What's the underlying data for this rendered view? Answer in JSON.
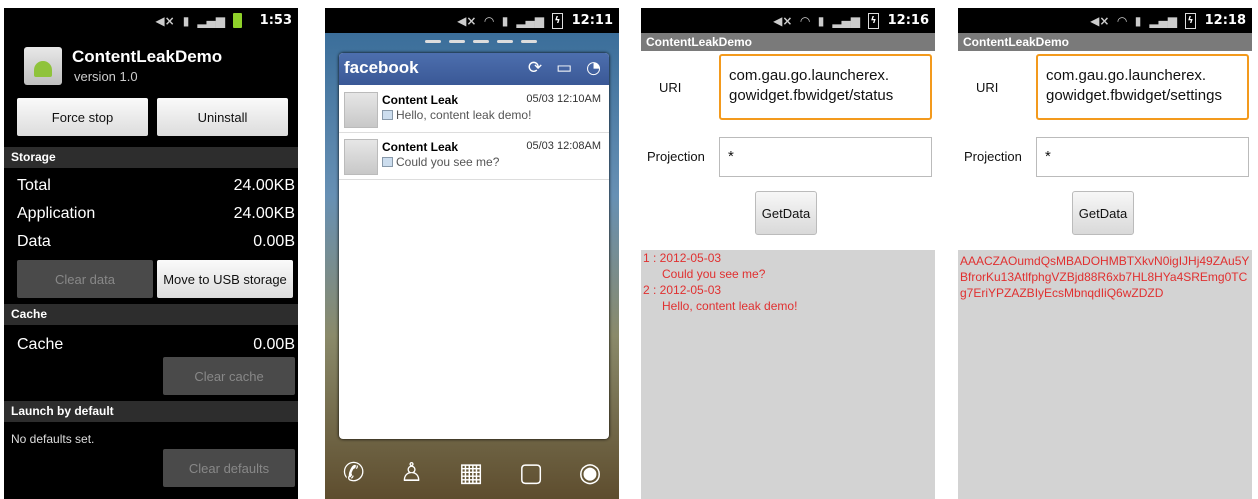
{
  "phone1": {
    "time": "1:53",
    "app_name": "ContentLeakDemo",
    "version": "version 1.0",
    "force_stop": "Force stop",
    "uninstall": "Uninstall",
    "storage_header": "Storage",
    "total_label": "Total",
    "total_value": "24.00KB",
    "application_label": "Application",
    "application_value": "24.00KB",
    "data_label": "Data",
    "data_value": "0.00B",
    "clear_data": "Clear data",
    "move_usb": "Move to USB storage",
    "cache_header": "Cache",
    "cache_label": "Cache",
    "cache_value": "0.00B",
    "clear_cache": "Clear cache",
    "launch_header": "Launch by default",
    "no_defaults": "No defaults set.",
    "clear_defaults": "Clear defaults"
  },
  "phone2": {
    "time": "12:11",
    "logo": "facebook",
    "items": [
      {
        "name": "Content Leak",
        "date": "05/03 12:10AM",
        "message": "Hello, content leak demo!"
      },
      {
        "name": "Content Leak",
        "date": "05/03 12:08AM",
        "message": "Could you see me?"
      }
    ]
  },
  "phone3": {
    "time": "12:16",
    "title": "ContentLeakDemo",
    "uri_label": "URI",
    "uri_line1": "com.gau.go.launcherex.",
    "uri_line2": "gowidget.fbwidget/status",
    "projection_label": "Projection",
    "projection_value": "*",
    "getdata": "GetData",
    "results": [
      {
        "line": "1 : 2012-05-03",
        "text": "Could you see me?"
      },
      {
        "line": "2 : 2012-05-03",
        "text": "Hello, content leak demo!"
      }
    ]
  },
  "phone4": {
    "time": "12:18",
    "title": "ContentLeakDemo",
    "uri_label": "URI",
    "uri_line1": "com.gau.go.launcherex.",
    "uri_line2": "gowidget.fbwidget/settings",
    "projection_label": "Projection",
    "projection_value": "*",
    "getdata": "GetData",
    "token": "AAACZAOumdQsMBADOHMBTXkvN0igIJHj49ZAu5YBfrorKu13AtlfphgVZBjd88R6xb7HL8HYa4SREmg0TCg7EriYPZAZBIyEcsMbnqdIiQ6wZDZD"
  },
  "colors": {
    "focus_orange": "#f39a1d",
    "facebook_blue": "#3b5998",
    "result_red": "#e03030",
    "result_bg": "#d3d3d3"
  }
}
